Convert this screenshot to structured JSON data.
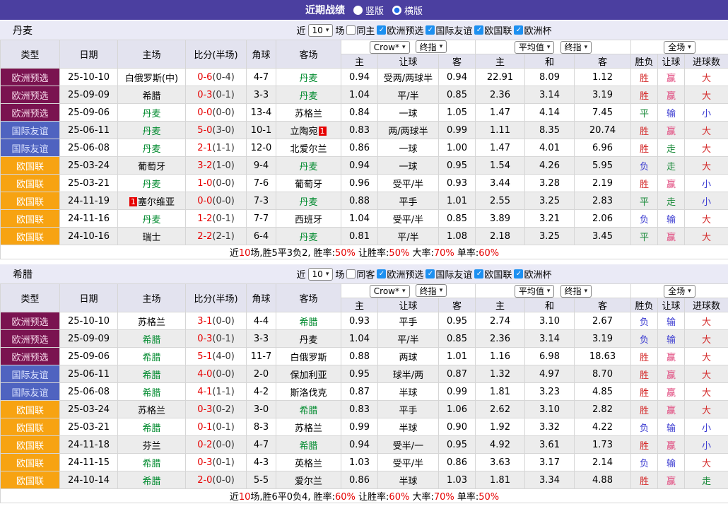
{
  "colors": {
    "topbar_bg": "#4b3fa0",
    "type_euro_qualifier": "#7a1350",
    "type_friendly": "#4f63c0",
    "type_nations_league": "#f7a312",
    "subject_team_green": "#008a2e",
    "score_red": "#e60000",
    "result_red": "#d42a2a",
    "result_green": "#1a8a3a",
    "result_blue": "#3939d0",
    "result_win_pink": "#e0457b",
    "handicap_cols_bg": "#fcf4ea",
    "average_cols_bg": "#e9f5fb",
    "checkbox_blue": "#1e90f0"
  },
  "topbar": {
    "title": "近期战绩",
    "radios": [
      {
        "label": "竖版",
        "checked": false
      },
      {
        "label": "横版",
        "checked": true
      }
    ]
  },
  "table_header": {
    "cols": [
      "类型",
      "日期",
      "主场",
      "比分(半场)",
      "角球",
      "客场"
    ],
    "g1_selects": [
      "Crow*",
      "终指"
    ],
    "g1_cols": [
      "主",
      "让球",
      "客"
    ],
    "g2_selects": [
      "平均值",
      "终指"
    ],
    "g2_cols": [
      "主",
      "和",
      "客"
    ],
    "g3_select": "全场",
    "g3_cols": [
      "胜负",
      "让球",
      "进球数"
    ]
  },
  "sections": [
    {
      "team": "丹麦",
      "filter": {
        "prefix": "近",
        "games": "10",
        "suffix": "场",
        "same_label": "同主",
        "same_checked": false,
        "leagues": [
          {
            "label": "欧洲预选",
            "checked": true
          },
          {
            "label": "国际友谊",
            "checked": true
          },
          {
            "label": "欧国联",
            "checked": true
          },
          {
            "label": "欧洲杯",
            "checked": true
          }
        ]
      },
      "rows": [
        {
          "type": "欧洲预选",
          "tk": "eq",
          "date": "25-10-10",
          "home": {
            "name": "白俄罗斯(中)"
          },
          "score": "0-6",
          "half": "(0-4)",
          "corner": "4-7",
          "away": {
            "name": "丹麦",
            "green": true
          },
          "o": [
            "0.94",
            "受两/两球半",
            "0.94",
            "22.91",
            "8.09",
            "1.12"
          ],
          "r": [
            [
              "胜",
              "red"
            ],
            [
              "赢",
              "pink"
            ],
            [
              "大",
              "red"
            ]
          ]
        },
        {
          "type": "欧洲预选",
          "tk": "eq",
          "date": "25-09-09",
          "home": {
            "name": "希腊"
          },
          "score": "0-3",
          "half": "(0-1)",
          "corner": "3-3",
          "away": {
            "name": "丹麦",
            "green": true
          },
          "o": [
            "1.04",
            "平/半",
            "0.85",
            "2.36",
            "3.14",
            "3.19"
          ],
          "r": [
            [
              "胜",
              "red"
            ],
            [
              "赢",
              "pink"
            ],
            [
              "大",
              "red"
            ]
          ]
        },
        {
          "type": "欧洲预选",
          "tk": "eq",
          "date": "25-09-06",
          "home": {
            "name": "丹麦",
            "green": true
          },
          "score": "0-0",
          "half": "(0-0)",
          "corner": "13-4",
          "away": {
            "name": "苏格兰"
          },
          "o": [
            "0.84",
            "一球",
            "1.05",
            "1.47",
            "4.14",
            "7.45"
          ],
          "r": [
            [
              "平",
              "green"
            ],
            [
              "输",
              "blue"
            ],
            [
              "小",
              "blue"
            ]
          ]
        },
        {
          "type": "国际友谊",
          "tk": "fr",
          "date": "25-06-11",
          "home": {
            "name": "丹麦",
            "green": true
          },
          "score": "5-0",
          "half": "(3-0)",
          "corner": "10-1",
          "away": {
            "name": "立陶宛",
            "badge_after": "1"
          },
          "o": [
            "0.83",
            "两/两球半",
            "0.99",
            "1.11",
            "8.35",
            "20.74"
          ],
          "r": [
            [
              "胜",
              "red"
            ],
            [
              "赢",
              "pink"
            ],
            [
              "大",
              "red"
            ]
          ]
        },
        {
          "type": "国际友谊",
          "tk": "fr",
          "date": "25-06-08",
          "home": {
            "name": "丹麦",
            "green": true
          },
          "score": "2-1",
          "half": "(1-1)",
          "corner": "12-0",
          "away": {
            "name": "北爱尔兰"
          },
          "o": [
            "0.86",
            "一球",
            "1.00",
            "1.47",
            "4.01",
            "6.96"
          ],
          "r": [
            [
              "胜",
              "red"
            ],
            [
              "走",
              "green"
            ],
            [
              "大",
              "red"
            ]
          ]
        },
        {
          "type": "欧国联",
          "tk": "na",
          "date": "25-03-24",
          "home": {
            "name": "葡萄牙"
          },
          "score": "3-2",
          "half": "(1-0)",
          "corner": "9-4",
          "away": {
            "name": "丹麦",
            "green": true
          },
          "o": [
            "0.94",
            "一球",
            "0.95",
            "1.54",
            "4.26",
            "5.95"
          ],
          "r": [
            [
              "负",
              "blue"
            ],
            [
              "走",
              "green"
            ],
            [
              "大",
              "red"
            ]
          ]
        },
        {
          "type": "欧国联",
          "tk": "na",
          "date": "25-03-21",
          "home": {
            "name": "丹麦",
            "green": true
          },
          "score": "1-0",
          "half": "(0-0)",
          "corner": "7-6",
          "away": {
            "name": "葡萄牙"
          },
          "o": [
            "0.96",
            "受平/半",
            "0.93",
            "3.44",
            "3.28",
            "2.19"
          ],
          "r": [
            [
              "胜",
              "red"
            ],
            [
              "赢",
              "pink"
            ],
            [
              "小",
              "blue"
            ]
          ]
        },
        {
          "type": "欧国联",
          "tk": "na",
          "date": "24-11-19",
          "home": {
            "name": "塞尔维亚",
            "badge_before": "1"
          },
          "score": "0-0",
          "half": "(0-0)",
          "corner": "7-3",
          "away": {
            "name": "丹麦",
            "green": true
          },
          "o": [
            "0.88",
            "平手",
            "1.01",
            "2.55",
            "3.25",
            "2.83"
          ],
          "r": [
            [
              "平",
              "green"
            ],
            [
              "走",
              "green"
            ],
            [
              "小",
              "blue"
            ]
          ]
        },
        {
          "type": "欧国联",
          "tk": "na",
          "date": "24-11-16",
          "home": {
            "name": "丹麦",
            "green": true
          },
          "score": "1-2",
          "half": "(0-1)",
          "corner": "7-7",
          "away": {
            "name": "西班牙"
          },
          "o": [
            "1.04",
            "受平/半",
            "0.85",
            "3.89",
            "3.21",
            "2.06"
          ],
          "r": [
            [
              "负",
              "blue"
            ],
            [
              "输",
              "blue"
            ],
            [
              "大",
              "red"
            ]
          ]
        },
        {
          "type": "欧国联",
          "tk": "na",
          "date": "24-10-16",
          "home": {
            "name": "瑞士"
          },
          "score": "2-2",
          "half": "(2-1)",
          "corner": "6-4",
          "away": {
            "name": "丹麦",
            "green": true
          },
          "o": [
            "0.81",
            "平/半",
            "1.08",
            "2.18",
            "3.25",
            "3.45"
          ],
          "r": [
            [
              "平",
              "green"
            ],
            [
              "赢",
              "pink"
            ],
            [
              "大",
              "red"
            ]
          ]
        }
      ],
      "summary": [
        {
          "t": "近"
        },
        {
          "t": "10",
          "r": true
        },
        {
          "t": "场,胜5平3负2, 胜率:"
        },
        {
          "t": "50%",
          "r": true
        },
        {
          "t": " 让胜率:"
        },
        {
          "t": "50%",
          "r": true
        },
        {
          "t": " 大率:"
        },
        {
          "t": "70%",
          "r": true
        },
        {
          "t": " 单率:"
        },
        {
          "t": "60%",
          "r": true
        }
      ]
    },
    {
      "team": "希腊",
      "filter": {
        "prefix": "近",
        "games": "10",
        "suffix": "场",
        "same_label": "同客",
        "same_checked": false,
        "leagues": [
          {
            "label": "欧洲预选",
            "checked": true
          },
          {
            "label": "国际友谊",
            "checked": true
          },
          {
            "label": "欧国联",
            "checked": true
          },
          {
            "label": "欧洲杯",
            "checked": true
          }
        ]
      },
      "rows": [
        {
          "type": "欧洲预选",
          "tk": "eq",
          "date": "25-10-10",
          "home": {
            "name": "苏格兰"
          },
          "score": "3-1",
          "half": "(0-0)",
          "corner": "4-4",
          "away": {
            "name": "希腊",
            "green": true
          },
          "o": [
            "0.93",
            "平手",
            "0.95",
            "2.74",
            "3.10",
            "2.67"
          ],
          "r": [
            [
              "负",
              "blue"
            ],
            [
              "输",
              "blue"
            ],
            [
              "大",
              "red"
            ]
          ]
        },
        {
          "type": "欧洲预选",
          "tk": "eq",
          "date": "25-09-09",
          "home": {
            "name": "希腊",
            "green": true
          },
          "score": "0-3",
          "half": "(0-1)",
          "corner": "3-3",
          "away": {
            "name": "丹麦"
          },
          "o": [
            "1.04",
            "平/半",
            "0.85",
            "2.36",
            "3.14",
            "3.19"
          ],
          "r": [
            [
              "负",
              "blue"
            ],
            [
              "输",
              "blue"
            ],
            [
              "大",
              "red"
            ]
          ]
        },
        {
          "type": "欧洲预选",
          "tk": "eq",
          "date": "25-09-06",
          "home": {
            "name": "希腊",
            "green": true
          },
          "score": "5-1",
          "half": "(4-0)",
          "corner": "11-7",
          "away": {
            "name": "白俄罗斯"
          },
          "o": [
            "0.88",
            "两球",
            "1.01",
            "1.16",
            "6.98",
            "18.63"
          ],
          "r": [
            [
              "胜",
              "red"
            ],
            [
              "赢",
              "pink"
            ],
            [
              "大",
              "red"
            ]
          ]
        },
        {
          "type": "国际友谊",
          "tk": "fr",
          "date": "25-06-11",
          "home": {
            "name": "希腊",
            "green": true
          },
          "score": "4-0",
          "half": "(0-0)",
          "corner": "2-0",
          "away": {
            "name": "保加利亚"
          },
          "o": [
            "0.95",
            "球半/两",
            "0.87",
            "1.32",
            "4.97",
            "8.70"
          ],
          "r": [
            [
              "胜",
              "red"
            ],
            [
              "赢",
              "pink"
            ],
            [
              "大",
              "red"
            ]
          ]
        },
        {
          "type": "国际友谊",
          "tk": "fr",
          "date": "25-06-08",
          "home": {
            "name": "希腊",
            "green": true
          },
          "score": "4-1",
          "half": "(1-1)",
          "corner": "4-2",
          "away": {
            "name": "斯洛伐克"
          },
          "o": [
            "0.87",
            "半球",
            "0.99",
            "1.81",
            "3.23",
            "4.85"
          ],
          "r": [
            [
              "胜",
              "red"
            ],
            [
              "赢",
              "pink"
            ],
            [
              "大",
              "red"
            ]
          ]
        },
        {
          "type": "欧国联",
          "tk": "na",
          "date": "25-03-24",
          "home": {
            "name": "苏格兰"
          },
          "score": "0-3",
          "half": "(0-2)",
          "corner": "3-0",
          "away": {
            "name": "希腊",
            "green": true
          },
          "o": [
            "0.83",
            "平手",
            "1.06",
            "2.62",
            "3.10",
            "2.82"
          ],
          "r": [
            [
              "胜",
              "red"
            ],
            [
              "赢",
              "pink"
            ],
            [
              "大",
              "red"
            ]
          ]
        },
        {
          "type": "欧国联",
          "tk": "na",
          "date": "25-03-21",
          "home": {
            "name": "希腊",
            "green": true
          },
          "score": "0-1",
          "half": "(0-1)",
          "corner": "8-3",
          "away": {
            "name": "苏格兰"
          },
          "o": [
            "0.99",
            "半球",
            "0.90",
            "1.92",
            "3.32",
            "4.22"
          ],
          "r": [
            [
              "负",
              "blue"
            ],
            [
              "输",
              "blue"
            ],
            [
              "小",
              "blue"
            ]
          ]
        },
        {
          "type": "欧国联",
          "tk": "na",
          "date": "24-11-18",
          "home": {
            "name": "芬兰"
          },
          "score": "0-2",
          "half": "(0-0)",
          "corner": "4-7",
          "away": {
            "name": "希腊",
            "green": true
          },
          "o": [
            "0.94",
            "受半/一",
            "0.95",
            "4.92",
            "3.61",
            "1.73"
          ],
          "r": [
            [
              "胜",
              "red"
            ],
            [
              "赢",
              "pink"
            ],
            [
              "小",
              "blue"
            ]
          ]
        },
        {
          "type": "欧国联",
          "tk": "na",
          "date": "24-11-15",
          "home": {
            "name": "希腊",
            "green": true
          },
          "score": "0-3",
          "half": "(0-1)",
          "corner": "4-3",
          "away": {
            "name": "英格兰"
          },
          "o": [
            "1.03",
            "受平/半",
            "0.86",
            "3.63",
            "3.17",
            "2.14"
          ],
          "r": [
            [
              "负",
              "blue"
            ],
            [
              "输",
              "blue"
            ],
            [
              "大",
              "red"
            ]
          ]
        },
        {
          "type": "欧国联",
          "tk": "na",
          "date": "24-10-14",
          "home": {
            "name": "希腊",
            "green": true
          },
          "score": "2-0",
          "half": "(0-0)",
          "corner": "5-5",
          "away": {
            "name": "爱尔兰"
          },
          "o": [
            "0.86",
            "半球",
            "1.03",
            "1.81",
            "3.34",
            "4.88"
          ],
          "r": [
            [
              "胜",
              "red"
            ],
            [
              "赢",
              "pink"
            ],
            [
              "走",
              "green"
            ]
          ]
        }
      ],
      "summary": [
        {
          "t": "近"
        },
        {
          "t": "10",
          "r": true
        },
        {
          "t": "场,胜6平0负4, 胜率:"
        },
        {
          "t": "60%",
          "r": true
        },
        {
          "t": " 让胜率:"
        },
        {
          "t": "60%",
          "r": true
        },
        {
          "t": " 大率:"
        },
        {
          "t": "70%",
          "r": true
        },
        {
          "t": " 单率:"
        },
        {
          "t": "50%",
          "r": true
        }
      ]
    }
  ]
}
